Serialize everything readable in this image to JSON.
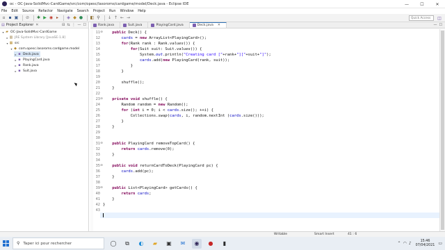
{
  "window": {
    "title": "oc - OC-Java-SolidMvc-CardGame/src/com/opesc/lasoroms/cardgame/model/Deck.java - Eclipse IDE",
    "controls": {
      "minimize": "—",
      "maximize": "☐",
      "close": "✕"
    }
  },
  "menu": [
    "File",
    "Edit",
    "Source",
    "Refactor",
    "Navigate",
    "Search",
    "Project",
    "Run",
    "Window",
    "Help"
  ],
  "toolbar": {
    "quick_access_placeholder": "Quick Access"
  },
  "explorer": {
    "title": "Project Explorer",
    "items": [
      {
        "label": "OC-Java-SolidMvc-CardGame",
        "level": 0,
        "toggle": "▾",
        "icon": "project-icon"
      },
      {
        "label": "JRE System Library [JavaSE-1.8]",
        "level": 1,
        "toggle": "▸",
        "icon": "library-icon"
      },
      {
        "label": "src",
        "level": 1,
        "toggle": "▾",
        "icon": "source-folder-icon"
      },
      {
        "label": "com.opesc.lasoroms.cardgame.model",
        "level": 2,
        "toggle": "▾",
        "icon": "package-icon"
      },
      {
        "label": "Deck.java",
        "level": 3,
        "toggle": "▸",
        "icon": "java-file-icon",
        "selected": true
      },
      {
        "label": "PlayingCard.java",
        "level": 3,
        "toggle": "▸",
        "icon": "java-file-icon"
      },
      {
        "label": "Rank.java",
        "level": 3,
        "toggle": "▸",
        "icon": "java-file-icon"
      },
      {
        "label": "Suit.java",
        "level": 3,
        "toggle": "▸",
        "icon": "java-file-icon"
      }
    ]
  },
  "editor": {
    "tabs": [
      {
        "label": "Rank.java",
        "active": false
      },
      {
        "label": "Suit.java",
        "active": false
      },
      {
        "label": "PlayingCard.java",
        "active": false
      },
      {
        "label": "Deck.java",
        "active": true
      }
    ],
    "lines": [
      {
        "n": "11",
        "text": "    public Deck() {",
        "fold": "⊖"
      },
      {
        "n": "12",
        "text": "        cards = new ArrayList<PlayingCard>();"
      },
      {
        "n": "13",
        "text": "        for(Rank rank : Rank.values()) {"
      },
      {
        "n": "14",
        "text": "            for(Suit suit: Suit.values()) {"
      },
      {
        "n": "15",
        "text": "                System.out.println(\"Creating card [\"+rank+\"][\"+suit+\"]\");"
      },
      {
        "n": "16",
        "text": "                cards.add(new PlayingCard(rank, suit));"
      },
      {
        "n": "17",
        "text": "            }"
      },
      {
        "n": "18",
        "text": "        }"
      },
      {
        "n": "19",
        "text": ""
      },
      {
        "n": "20",
        "text": "        shuffle();"
      },
      {
        "n": "21",
        "text": "    }"
      },
      {
        "n": "22",
        "text": ""
      },
      {
        "n": "23",
        "text": "    private void shuffle() {",
        "fold": "⊖"
      },
      {
        "n": "24",
        "text": "        Random random = new Random();"
      },
      {
        "n": "25",
        "text": "        for (int i = 0; i < cards.size(); ++i) {"
      },
      {
        "n": "26",
        "text": "            Collections.swap(cards, i, random.nextInt (cards.size()));"
      },
      {
        "n": "27",
        "text": "        }"
      },
      {
        "n": "28",
        "text": "    }"
      },
      {
        "n": "29",
        "text": ""
      },
      {
        "n": "30",
        "text": ""
      },
      {
        "n": "31",
        "text": "    public PlayingCard removeTopCard() {",
        "fold": "⊖"
      },
      {
        "n": "32",
        "text": "        return cards.remove(0);"
      },
      {
        "n": "33",
        "text": "    }"
      },
      {
        "n": "34",
        "text": ""
      },
      {
        "n": "35",
        "text": "    public void returnCardToDeck(PlayingCard pc) {",
        "fold": "⊖"
      },
      {
        "n": "36",
        "text": "        cards.add(pc);"
      },
      {
        "n": "37",
        "text": "    }"
      },
      {
        "n": "38",
        "text": ""
      },
      {
        "n": "39",
        "text": "    public List<PlayingCard> getCards() {",
        "fold": "⊖"
      },
      {
        "n": "40",
        "text": "        return cards;"
      },
      {
        "n": "41",
        "text": "    }"
      },
      {
        "n": "42",
        "text": "}"
      },
      {
        "n": "43",
        "text": ""
      }
    ]
  },
  "status": {
    "writable": "Writable",
    "insert_mode": "Smart Insert",
    "position": "41 : 6"
  },
  "taskbar": {
    "search_placeholder": "Taper ici pour rechercher",
    "time": "15:46",
    "date": "07/04/2021"
  },
  "colors": {
    "keyword": "#7f0055",
    "field": "#0000c0",
    "string": "#2a00ff",
    "selection": "#d8e6f5",
    "current_line": "#e8f2fe"
  }
}
